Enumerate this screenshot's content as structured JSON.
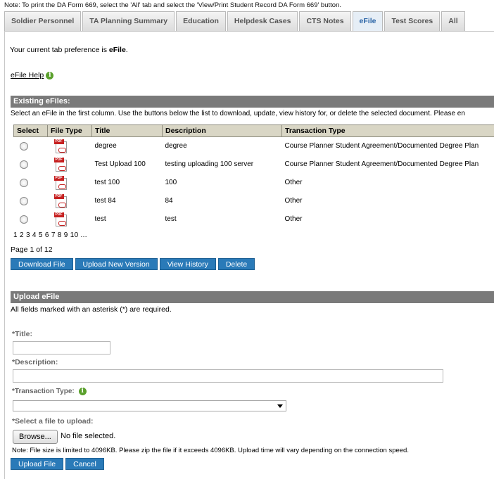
{
  "top_note": "Note: To print the DA Form 669, select the 'All' tab and select the 'View/Print Student Record DA Form 669' button.",
  "tabs": [
    {
      "label": "Soldier Personnel"
    },
    {
      "label": "TA Planning Summary"
    },
    {
      "label": "Education"
    },
    {
      "label": "Helpdesk Cases"
    },
    {
      "label": "CTS Notes"
    },
    {
      "label": "eFile",
      "active": true
    },
    {
      "label": "Test Scores"
    },
    {
      "label": "All"
    }
  ],
  "preference": {
    "text": "Your current tab preference is ",
    "value": "eFile",
    "suffix": "."
  },
  "help": {
    "link": "eFile Help",
    "icon": "info-icon"
  },
  "existing": {
    "header": "Existing eFiles:",
    "instructions": "Select an eFile in the first column. Use the buttons below the list to download, update, view history for, or delete the selected document. Please en",
    "columns": [
      "Select",
      "File Type",
      "Title",
      "Description",
      "Transaction Type"
    ],
    "rows": [
      {
        "title": "degree",
        "description": "degree",
        "transaction": "Course Planner Student Agreement/Documented Degree Plan"
      },
      {
        "title": "Test Upload 100",
        "description": "testing uploading 100 server",
        "transaction": "Course Planner Student Agreement/Documented Degree Plan"
      },
      {
        "title": "test 100",
        "description": "100",
        "transaction": "Other"
      },
      {
        "title": "test 84",
        "description": "84",
        "transaction": "Other"
      },
      {
        "title": "test",
        "description": "test",
        "transaction": "Other"
      }
    ],
    "pdf_tag": "PDF",
    "pages": [
      "1",
      "2",
      "3",
      "4",
      "5",
      "6",
      "7",
      "8",
      "9",
      "10",
      "..."
    ],
    "page_count": "Page 1 of 12",
    "buttons": {
      "download": "Download File",
      "upload_version": "Upload New Version",
      "history": "View History",
      "delete": "Delete"
    }
  },
  "upload": {
    "header": "Upload eFile",
    "required_note": "All fields marked with an asterisk (*) are required.",
    "title_label": "*Title:",
    "description_label": "*Description:",
    "transaction_label": "*Transaction Type:",
    "file_label": "*Select a file to upload:",
    "browse": "Browse...",
    "no_file": "No file selected.",
    "size_note": "Note: File size is limited to 4096KB. Please zip the file if it exceeds 4096KB. Upload time will vary depending on the connection speed.",
    "buttons": {
      "upload": "Upload File",
      "cancel": "Cancel"
    }
  },
  "colors": {
    "header_bg": "#7a7a7a",
    "button_bg": "#2a7ab8",
    "table_header_bg": "#d9d6c5",
    "active_tab": "#2b65a7"
  }
}
